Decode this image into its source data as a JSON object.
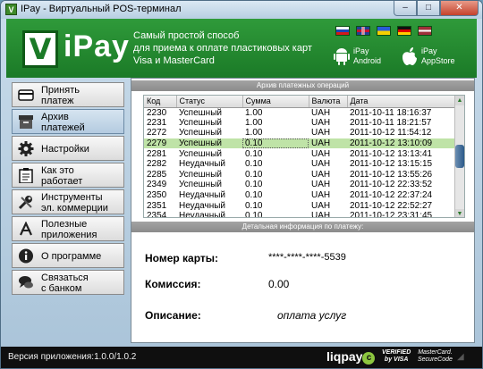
{
  "window": {
    "title": "IPay - Виртуальный POS-терминал",
    "min_label": "–",
    "max_label": "□",
    "close_label": "✕"
  },
  "header": {
    "logo_letter": "V",
    "logo_text": "iPay",
    "slogan": [
      "Самый простой способ",
      "для приема к оплате пластиковых карт",
      "Visa и MasterCard"
    ],
    "android": [
      "iPay",
      "Android"
    ],
    "appstore": [
      "iPay",
      "AppStore"
    ]
  },
  "sidebar": {
    "items": [
      {
        "label": "Принять\nплатеж",
        "icon": "card-icon",
        "active": false
      },
      {
        "label": "Архив\nплатежей",
        "icon": "archive-icon",
        "active": true
      },
      {
        "label": "Настройки",
        "icon": "gear-icon",
        "active": false
      },
      {
        "label": "Как это\nработает",
        "icon": "clipboard-icon",
        "active": false
      },
      {
        "label": "Инструменты\nэл. коммерции",
        "icon": "tools-icon",
        "active": false
      },
      {
        "label": "Полезные\nприложения",
        "icon": "appstore-icon",
        "active": false
      },
      {
        "label": "О программе",
        "icon": "info-icon",
        "active": false
      },
      {
        "label": "Связаться\nс банком",
        "icon": "chat-icon",
        "active": false
      }
    ]
  },
  "archive": {
    "section_title": "Архив платежных операций",
    "columns": [
      "Код",
      "Статус",
      "Сумма",
      "Валюта",
      "Дата"
    ],
    "rows": [
      [
        "2230",
        "Успешный",
        "1.00",
        "UAH",
        "2011-10-11 18:16:37"
      ],
      [
        "2231",
        "Успешный",
        "1.00",
        "UAH",
        "2011-10-11 18:21:57"
      ],
      [
        "2272",
        "Успешный",
        "1.00",
        "UAH",
        "2011-10-12 11:54:12"
      ],
      [
        "2279",
        "Успешный",
        "0.10",
        "UAH",
        "2011-10-12 13:10:09"
      ],
      [
        "2281",
        "Успешный",
        "0.10",
        "UAH",
        "2011-10-12 13:13:41"
      ],
      [
        "2282",
        "Неудачный",
        "0.10",
        "UAH",
        "2011-10-12 13:15:15"
      ],
      [
        "2285",
        "Успешный",
        "0.10",
        "UAH",
        "2011-10-12 13:55:26"
      ],
      [
        "2349",
        "Успешный",
        "0.10",
        "UAH",
        "2011-10-12 22:33:52"
      ],
      [
        "2350",
        "Неудачный",
        "0.10",
        "UAH",
        "2011-10-12 22:37:24"
      ],
      [
        "2351",
        "Неудачный",
        "0.10",
        "UAH",
        "2011-10-12 22:52:27"
      ],
      [
        "2354",
        "Неудачный",
        "0.10",
        "UAH",
        "2011-10-12 23:31:45"
      ]
    ],
    "selected_row": 3
  },
  "details": {
    "section_title": "Детальная информация по платежу:",
    "card_label": "Номер карты:",
    "card_value": "****-****-****-5539",
    "fee_label": "Комиссия:",
    "fee_value": "0.00",
    "desc_label": "Описание:",
    "desc_value": "оплата услуг"
  },
  "footer": {
    "version": "Версия приложения:1.0.0/1.0.2",
    "liqpay": "liqpay",
    "liqpay_mark": "c",
    "visa": [
      "VERIFIED",
      "by VISA"
    ],
    "mastercard": [
      "MasterCard.",
      "SecureCode"
    ]
  },
  "colors": {
    "brand_green": "#1b7a27",
    "selected_row": "#bfe3a7",
    "footer_bg": "#0f0f0f"
  }
}
